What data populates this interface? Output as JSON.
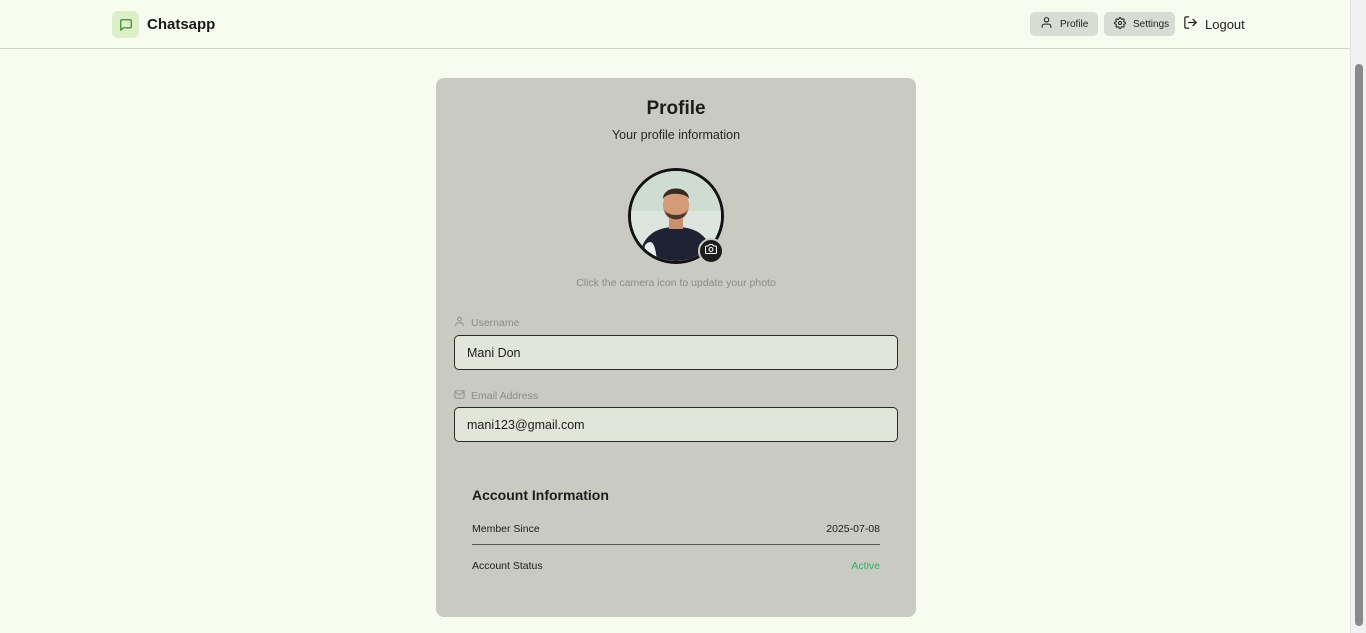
{
  "app": {
    "name": "Chatsapp"
  },
  "nav": {
    "profile_label": "Profile",
    "settings_label": "Settings",
    "logout_label": "Logout"
  },
  "profile": {
    "title": "Profile",
    "subtitle": "Your profile information",
    "photo_hint": "Click the camera icon to update your photo",
    "username_label": "Username",
    "username_value": "Mani Don",
    "email_label": "Email Address",
    "email_value": "mani123@gmail.com"
  },
  "account": {
    "title": "Account Information",
    "member_since_label": "Member Since",
    "member_since_value": "2025-07-08",
    "status_label": "Account Status",
    "status_value": "Active"
  },
  "colors": {
    "background": "#f8fcef",
    "card": "#c9cbc2",
    "input": "#e2e5da",
    "status_active": "#2fb260",
    "brand_logo_bg": "#dcefc9"
  },
  "icons": {
    "brand": "message-square-icon",
    "profile": "user-icon",
    "settings": "gear-icon",
    "logout": "logout-icon",
    "camera": "camera-icon",
    "username": "user-icon",
    "email": "mail-icon"
  }
}
